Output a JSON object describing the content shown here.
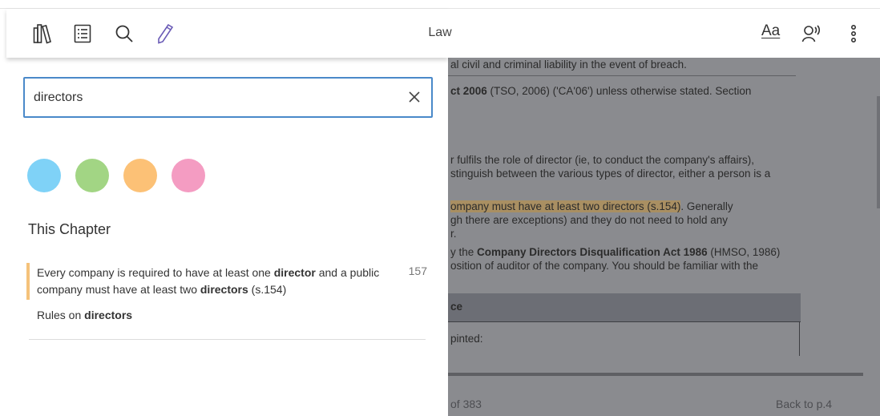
{
  "toolbar": {
    "title": "Law",
    "font_button_label": "Aa",
    "icons": [
      "library-icon",
      "contents-icon",
      "search-icon",
      "pencil-icon",
      "text-size-icon",
      "read-aloud-icon",
      "more-icon"
    ]
  },
  "search": {
    "value": "directors",
    "placeholder": ""
  },
  "highlight_colors": [
    "#7fd2f7",
    "#a2d584",
    "#fcc176",
    "#f49cc2"
  ],
  "results": {
    "section_title": "This Chapter",
    "items": [
      {
        "text_before": "Every company is required to have at least one ",
        "match1": "director",
        "text_middle": " and a public company must have at least two ",
        "match2": "directors",
        "text_after": " (s.154)",
        "page": "157",
        "highlight_color": "#f5c27a"
      },
      {
        "text_before": "Rules on ",
        "match1": "directors"
      }
    ]
  },
  "reader": {
    "line1": "al civil and criminal liability in the event of breach.",
    "line2_bold": "ct 2006",
    "line2_rest": " (TSO, 2006) ('CA'06') unless otherwise stated. Section",
    "line3": "r fulfils the role of director (ie, to conduct the company's affairs),",
    "line4": "stinguish between the various types of director, either a person is a",
    "line5_highlight": "ompany must have at least two directors (s.154)",
    "line5_rest": ". Generally",
    "line6": "gh there are exceptions) and they do not need to hold any",
    "line7": "r.",
    "line8_pre": "y the ",
    "line8_bold": "Company Directors Disqualification Act 1986",
    "line8_rest": " (HMSO, 1986)",
    "line9": "osition of auditor of the company. You should be familiar with the",
    "table_header": "ce",
    "table_row": "pinted:",
    "page_indicator": "of 383",
    "back_link": "Back to p.4"
  }
}
